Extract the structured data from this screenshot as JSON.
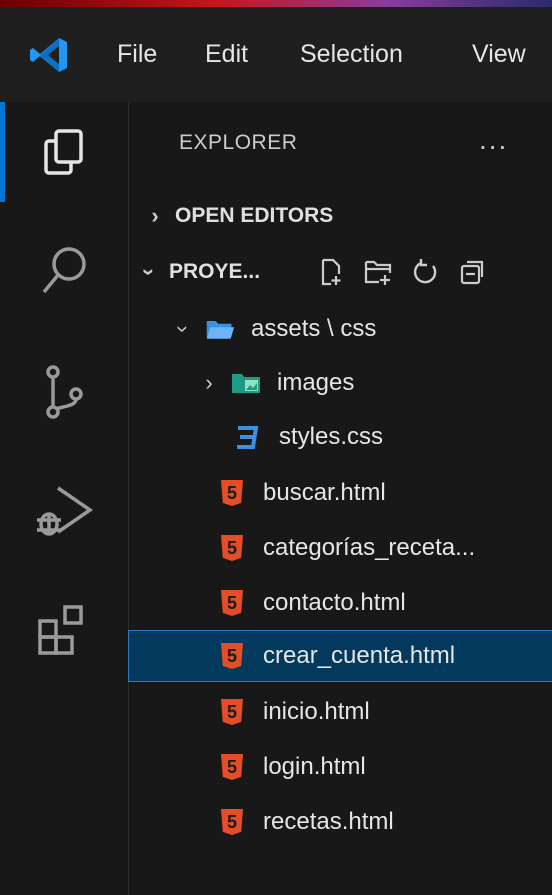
{
  "menu": [
    "File",
    "Edit",
    "Selection",
    "View"
  ],
  "explorer": {
    "title": "EXPLORER",
    "more": "...",
    "open_editors": "OPEN EDITORS",
    "project": "PROYE..."
  },
  "tree": {
    "assets_folder": "assets \\ css",
    "images_folder": "images",
    "styles_file": "styles.css",
    "files": [
      "buscar.html",
      "categorías_receta...",
      "contacto.html",
      "crear_cuenta.html",
      "inicio.html",
      "login.html",
      "recetas.html"
    ]
  },
  "colors": {
    "accent": "#0078d4",
    "html_icon": "#e44d26",
    "css_icon": "#3b8fe5",
    "selected_bg": "#04395e"
  },
  "icons": {
    "activity": [
      "explorer-icon",
      "search-icon",
      "source-control-icon",
      "run-debug-icon",
      "extensions-icon"
    ],
    "actions": [
      "new-file-icon",
      "new-folder-icon",
      "refresh-icon",
      "collapse-all-icon"
    ]
  }
}
